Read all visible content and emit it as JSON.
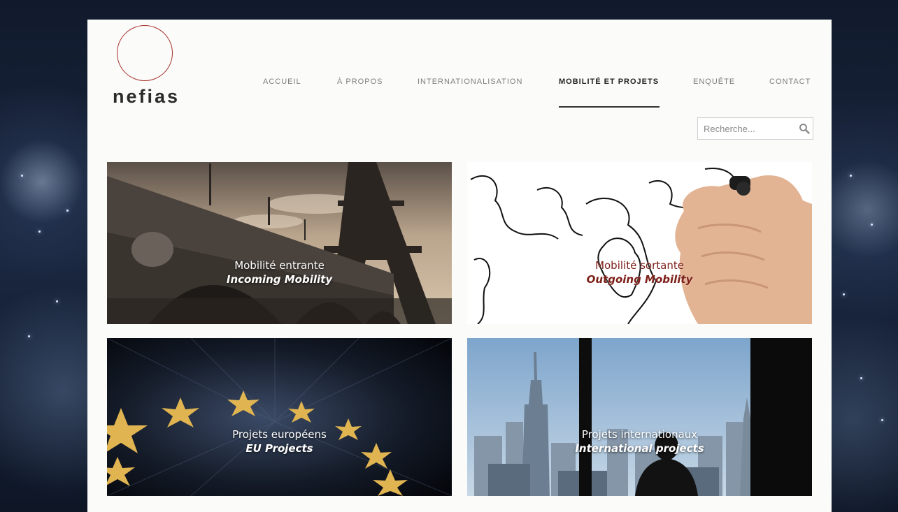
{
  "brand": {
    "name": "nefias",
    "accent_color": "#a8322b"
  },
  "nav": {
    "items": [
      {
        "label": "ACCUEIL",
        "active": false
      },
      {
        "label": "À PROPOS",
        "active": false
      },
      {
        "label": "INTERNATIONALISATION",
        "active": false
      },
      {
        "label": "MOBILITÉ ET PROJETS",
        "active": true
      },
      {
        "label": "ENQUÊTE",
        "active": false
      },
      {
        "label": "CONTACT",
        "active": false
      }
    ]
  },
  "search": {
    "placeholder": "Recherche...",
    "icon": "search-icon"
  },
  "tiles": [
    {
      "title_fr": "Mobilité entrante",
      "title_en": "Incoming Mobility"
    },
    {
      "title_fr": "Mobilité sortante",
      "title_en": "Outgoing Mobility"
    },
    {
      "title_fr": "Projets européens",
      "title_en": "EU Projects"
    },
    {
      "title_fr": "Projets internationaux",
      "title_en": "International projects"
    }
  ]
}
